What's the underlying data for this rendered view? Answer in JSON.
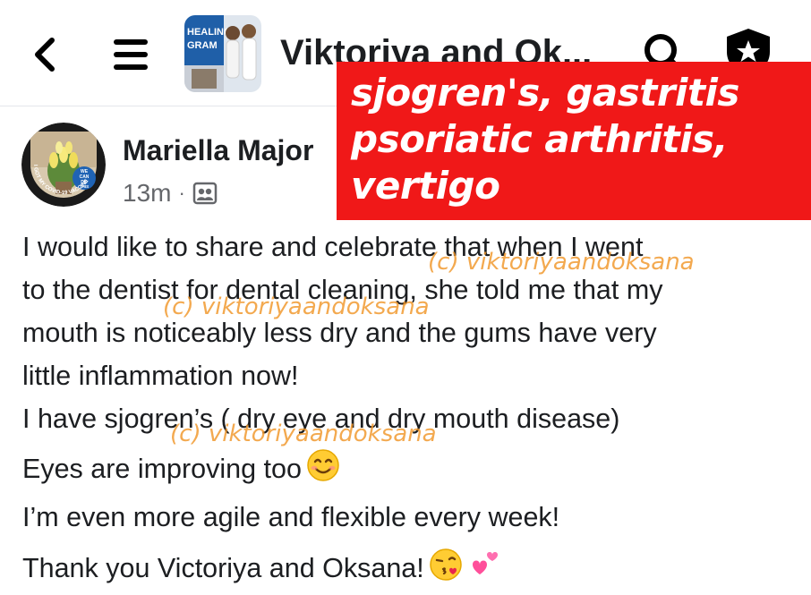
{
  "header": {
    "group_title": "Viktoriya and Ok...",
    "thumbnail_text_1": "HEALING",
    "thumbnail_text_2": "GRAM",
    "icons": {
      "back": "chevron-left-icon",
      "menu": "hamburger-menu-icon",
      "search": "search-icon",
      "admin": "shield-star-icon"
    }
  },
  "overlay": {
    "lines": [
      "sjogren's, gastritis",
      "psoriatic arthritis,",
      "vertigo"
    ],
    "background_color": "#f01818",
    "text_color": "#ffffff"
  },
  "post": {
    "author": "Mariella Major",
    "time": "13m",
    "separator": "·",
    "audience_icon": "group-members-icon",
    "avatar_badge_lines": [
      "WE",
      "CAN",
      "DO",
      "THIS"
    ],
    "avatar_ring_text": "I GOT MY COVID-19 VACCINE",
    "body_lines": [
      "I would like to share and celebrate that when I went",
      "to the dentist for dental cleaning, she told me that my",
      "mouth is noticeably less dry and the gums have very",
      "little inflammation now!",
      "I have sjogren’s ( dry eye and dry mouth disease)",
      "Eyes are improving too",
      "I’m even more agile and flexible every week!",
      "Thank you Victoriya and Oksana!"
    ],
    "emojis": {
      "smile": "smiling-face-emoji",
      "kiss": "face-blowing-kiss-emoji",
      "hearts": "two-hearts-emoji"
    }
  },
  "watermark": "(c) viktoriyaandoksana",
  "colors": {
    "text_primary": "#1c1e21",
    "text_secondary": "#65676b",
    "watermark": "#f09628",
    "divider": "#e4e6eb"
  }
}
